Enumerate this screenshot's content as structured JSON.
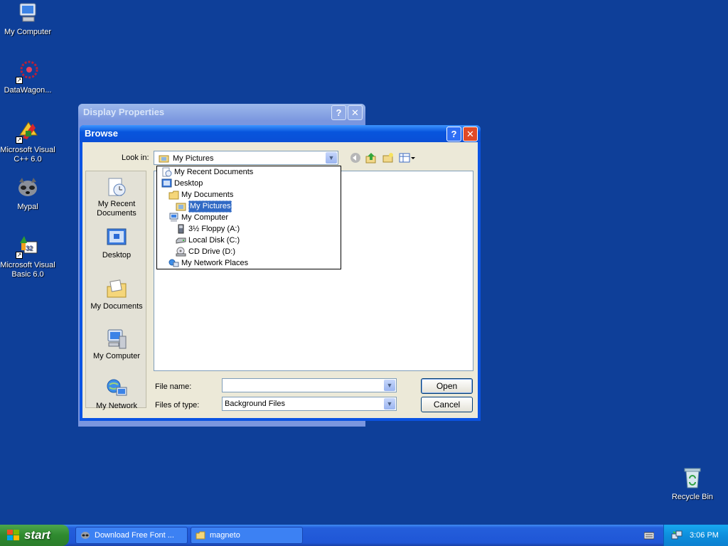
{
  "desktop": {
    "icons": [
      {
        "label": "My Computer",
        "icon": "computer-icon"
      },
      {
        "label": "DataWagon...",
        "icon": "datawagon-icon"
      },
      {
        "label": "Microsoft Visual C++ 6.0",
        "icon": "visual-cpp-icon"
      },
      {
        "label": "Mypal",
        "icon": "mypal-icon"
      },
      {
        "label": "Microsoft Visual Basic 6.0",
        "icon": "visual-basic-icon"
      },
      {
        "label": "Recycle Bin",
        "icon": "recycle-bin-icon"
      }
    ]
  },
  "display_properties": {
    "title": "Display Properties",
    "help_glyph": "?",
    "close_glyph": "✕"
  },
  "browse": {
    "title": "Browse",
    "help_glyph": "?",
    "close_glyph": "✕",
    "look_in_label": "Look in:",
    "look_in_value": "My Pictures",
    "places": [
      {
        "label": "My Recent Documents",
        "icon": "recent-documents-icon"
      },
      {
        "label": "Desktop",
        "icon": "desktop-icon"
      },
      {
        "label": "My Documents",
        "icon": "my-documents-icon"
      },
      {
        "label": "My Computer",
        "icon": "my-computer-icon"
      },
      {
        "label": "My Network",
        "icon": "my-network-icon"
      }
    ],
    "dropdown": [
      {
        "label": "My Recent Documents",
        "indent": 0,
        "icon": "recent-documents-icon",
        "selected": false
      },
      {
        "label": "Desktop",
        "indent": 0,
        "icon": "desktop-icon",
        "selected": false
      },
      {
        "label": "My Documents",
        "indent": 1,
        "icon": "folder-icon",
        "selected": false
      },
      {
        "label": "My Pictures",
        "indent": 2,
        "icon": "pictures-folder-icon",
        "selected": true
      },
      {
        "label": "My Computer",
        "indent": 1,
        "icon": "computer-icon",
        "selected": false
      },
      {
        "label": "3½ Floppy (A:)",
        "indent": 2,
        "icon": "floppy-icon",
        "selected": false
      },
      {
        "label": "Local Disk (C:)",
        "indent": 2,
        "icon": "hard-disk-icon",
        "selected": false
      },
      {
        "label": "CD Drive (D:)",
        "indent": 2,
        "icon": "cd-drive-icon",
        "selected": false
      },
      {
        "label": "My Network Places",
        "indent": 1,
        "icon": "network-icon",
        "selected": false
      }
    ],
    "file_name_label": "File name:",
    "file_name_value": "",
    "files_of_type_label": "Files of type:",
    "files_of_type_value": "Background Files",
    "open_label": "Open",
    "cancel_label": "Cancel"
  },
  "taskbar": {
    "start_label": "start",
    "tasks": [
      {
        "label": "Download Free Font ...",
        "icon": "raccoon-icon"
      },
      {
        "label": "magneto",
        "icon": "folder-icon"
      }
    ],
    "clock": "3:06 PM"
  }
}
